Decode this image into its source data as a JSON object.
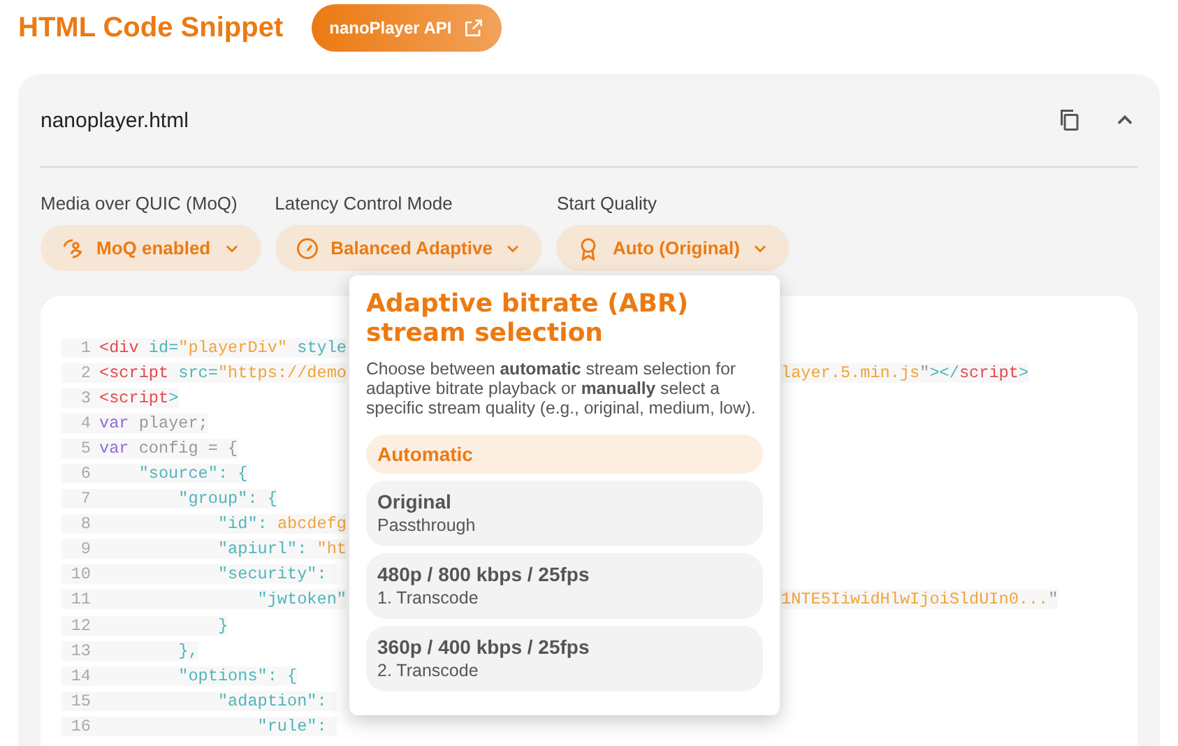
{
  "header": {
    "title": "HTML Code Snippet",
    "api_button": "nanoPlayer API"
  },
  "card": {
    "filename": "nanoplayer.html",
    "settings": [
      {
        "label": "Media over QUIC (MoQ)",
        "value": "MoQ enabled",
        "kind": "moq"
      },
      {
        "label": "Latency Control Mode",
        "value": "Balanced Adaptive",
        "kind": "latency"
      },
      {
        "label": "Start Quality",
        "value": "Auto (Original)",
        "kind": "quality"
      }
    ],
    "code": [
      {
        "n": "1",
        "left": [
          {
            "t": "<div",
            "kind": "tag"
          },
          {
            "t": " id=",
            "kind": "attr"
          },
          {
            "t": "\"playerDiv\"",
            "kind": "str"
          },
          {
            "t": " style",
            "kind": "attr"
          }
        ]
      },
      {
        "n": "2",
        "left": [
          {
            "t": "<script",
            "kind": "tag"
          },
          {
            "t": " src=",
            "kind": "attr"
          },
          {
            "t": "\"https://demo",
            "kind": "str"
          }
        ],
        "right": [
          {
            "t": "layer.5.min.js",
            "kind": "str"
          },
          {
            "t": "\"",
            "kind": "plain"
          },
          {
            "t": "></",
            "kind": "attr"
          },
          {
            "t": "script",
            "kind": "tag"
          },
          {
            "t": ">",
            "kind": "attr"
          }
        ]
      },
      {
        "n": "3",
        "left": [
          {
            "t": "<script",
            "kind": "tag"
          },
          {
            "t": ">",
            "kind": "attr"
          }
        ]
      },
      {
        "n": "4",
        "left": [
          {
            "t": "var",
            "kind": "kw"
          },
          {
            "t": " player;",
            "kind": "plain"
          }
        ]
      },
      {
        "n": "5",
        "left": [
          {
            "t": "var",
            "kind": "kw"
          },
          {
            "t": " config = {",
            "kind": "plain"
          }
        ]
      },
      {
        "n": "6",
        "left": [
          {
            "t": "    \"source\": {",
            "kind": "attr"
          }
        ]
      },
      {
        "n": "7",
        "left": [
          {
            "t": "        \"group\": {",
            "kind": "attr"
          }
        ]
      },
      {
        "n": "8",
        "left": [
          {
            "t": "            \"id\": ",
            "kind": "attr"
          },
          {
            "t": "abcdefg",
            "kind": "str"
          }
        ]
      },
      {
        "n": "9",
        "left": [
          {
            "t": "            \"apiurl\": ",
            "kind": "attr"
          },
          {
            "t": "\"ht",
            "kind": "str"
          }
        ]
      },
      {
        "n": "10",
        "left": [
          {
            "t": "            \"security\": ",
            "kind": "attr"
          }
        ]
      },
      {
        "n": "11",
        "left": [
          {
            "t": "                \"jwtoken\"",
            "kind": "attr"
          }
        ],
        "right": [
          {
            "t": "1NTE5IiwidHlwIjoiSldUIn0...",
            "kind": "str"
          },
          {
            "t": "\"",
            "kind": "plain"
          }
        ]
      },
      {
        "n": "12",
        "left": [
          {
            "t": "            }",
            "kind": "attr"
          }
        ]
      },
      {
        "n": "13",
        "left": [
          {
            "t": "        },",
            "kind": "attr"
          }
        ]
      },
      {
        "n": "14",
        "left": [
          {
            "t": "        \"options\": {",
            "kind": "attr"
          }
        ]
      },
      {
        "n": "15",
        "left": [
          {
            "t": "            \"adaption\": ",
            "kind": "attr"
          }
        ]
      },
      {
        "n": "16",
        "left": [
          {
            "t": "                \"rule\": ",
            "kind": "attr"
          }
        ]
      }
    ]
  },
  "popover": {
    "title": "Adaptive bitrate (ABR) stream selection",
    "description": "Choose between **automatic** stream selection for adaptive bitrate playback or **manually** select a specific stream quality (e.g., original, medium, low).",
    "options": [
      {
        "label": "Automatic",
        "selected": true
      },
      {
        "label": "Original",
        "sub": "Passthrough",
        "selected": false
      },
      {
        "label": "480p / 800 kbps / 25fps",
        "sub": "1. Transcode",
        "selected": false
      },
      {
        "label": "360p / 400 kbps / 25fps",
        "sub": "2. Transcode",
        "selected": false
      }
    ]
  }
}
